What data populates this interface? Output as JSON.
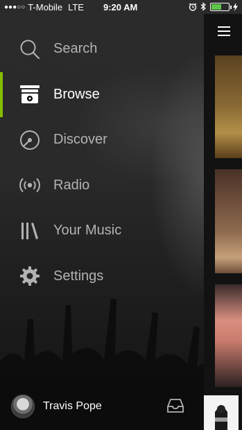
{
  "status_bar": {
    "signal": "●●●○○",
    "carrier": "T-Mobile",
    "network": "LTE",
    "time": "9:20 AM"
  },
  "menu": {
    "items": [
      {
        "label": "Search",
        "icon": "search-icon"
      },
      {
        "label": "Browse",
        "icon": "browse-icon",
        "active": true
      },
      {
        "label": "Discover",
        "icon": "discover-icon"
      },
      {
        "label": "Radio",
        "icon": "radio-icon"
      },
      {
        "label": "Your Music",
        "icon": "your-music-icon"
      },
      {
        "label": "Settings",
        "icon": "gear-icon"
      }
    ]
  },
  "profile": {
    "name": "Travis Pope"
  },
  "colors": {
    "accent": "#84bd00",
    "inactive_text": "#b3b3b3",
    "active_text": "#ffffff"
  }
}
